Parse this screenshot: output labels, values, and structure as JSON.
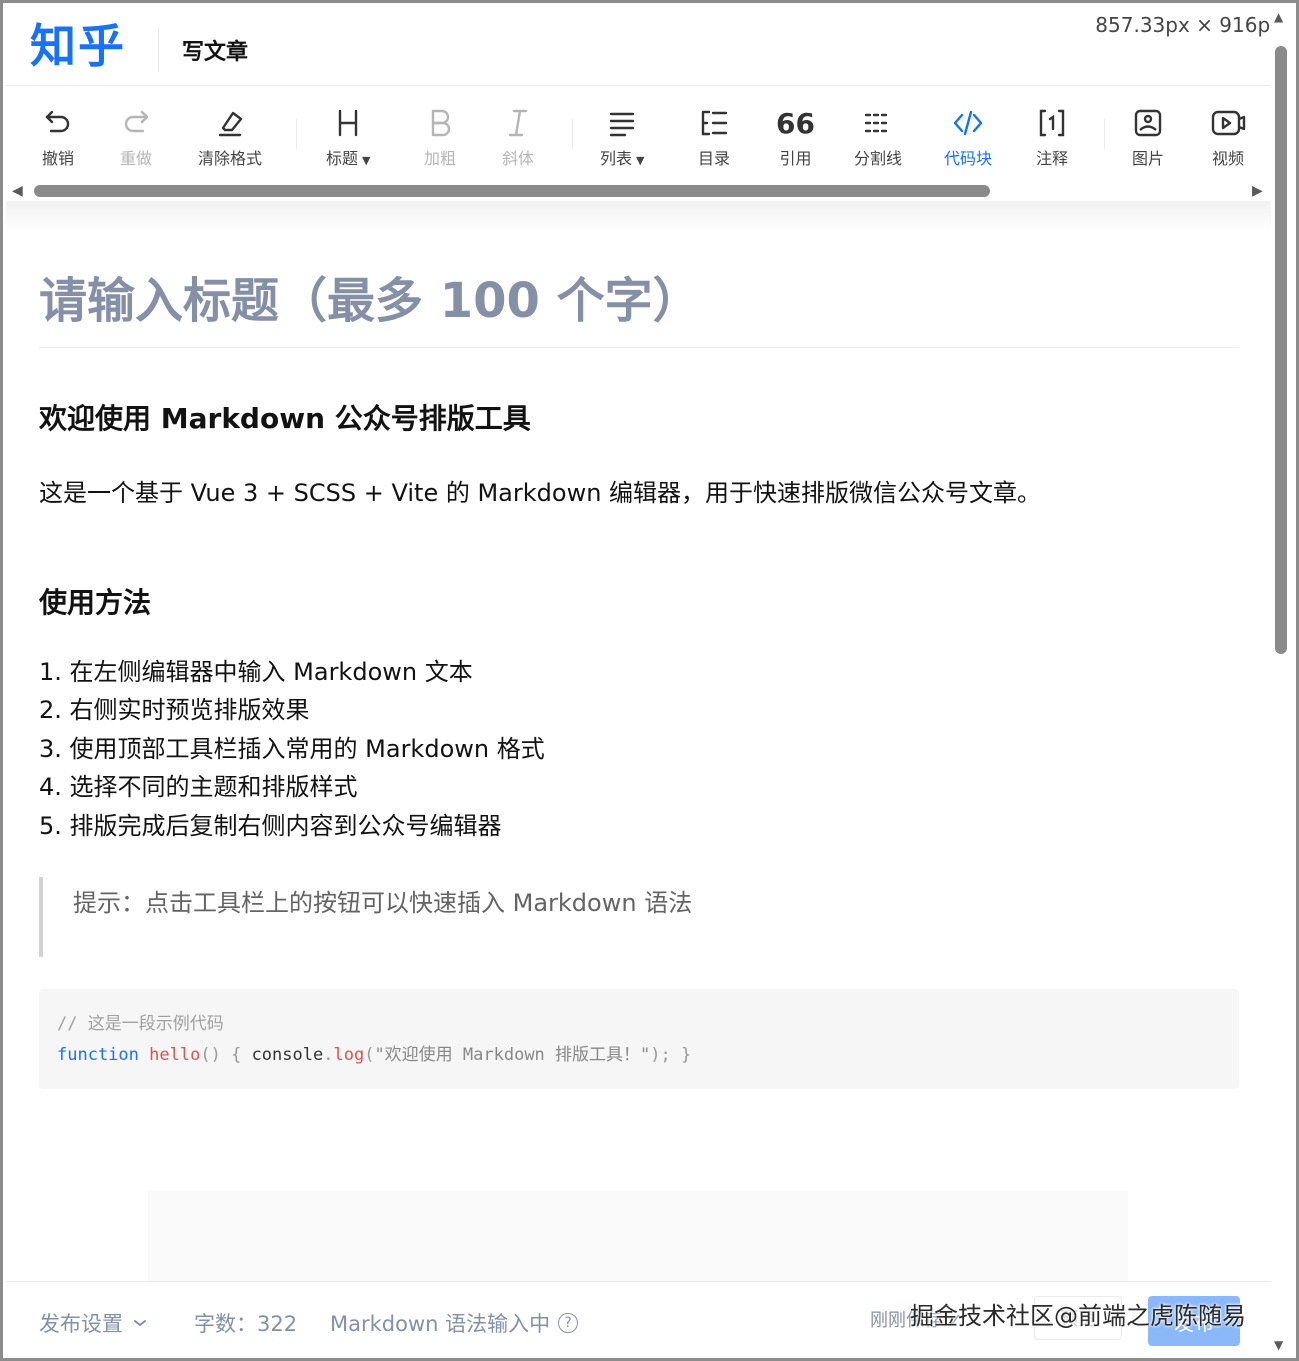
{
  "header": {
    "logo": "知乎",
    "title": "写文章",
    "dimensions_overlay": "857.33px × 916px"
  },
  "toolbar": {
    "undo": "撤销",
    "redo": "重做",
    "clear_format": "清除格式",
    "heading": "标题",
    "bold": "加粗",
    "italic": "斜体",
    "list": "列表",
    "toc": "目录",
    "quote": "引用",
    "divider": "分割线",
    "code_block": "代码块",
    "annotation": "注释",
    "image": "图片",
    "video": "视频"
  },
  "editor": {
    "title_placeholder": "请输入标题（最多 100 个字）",
    "h2_welcome": "欢迎使用 Markdown 公众号排版工具",
    "intro": "这是一个基于 Vue 3 + SCSS + Vite 的 Markdown 编辑器，用于快速排版微信公众号文章。",
    "h2_usage": "使用方法",
    "steps": [
      "1. 在左侧编辑器中输入 Markdown 文本",
      "2. 右侧实时预览排版效果",
      "3. 使用顶部工具栏插入常用的 Markdown 格式",
      "4. 选择不同的主题和排版样式",
      "5. 排版完成后复制右侧内容到公众号编辑器"
    ],
    "tip": "提示：点击工具栏上的按钮可以快速插入 Markdown 语法",
    "code": {
      "comment": "// 这是一段示例代码",
      "keyword": "function",
      "fn_name": "hello",
      "parens": "()",
      "brace_open": "{",
      "obj": "console",
      "dot": ".",
      "method": "log",
      "arg_open": "(",
      "string": "\"欢迎使用 Markdown 排版工具！\"",
      "arg_close": ");",
      "brace_close": "}"
    }
  },
  "footer": {
    "publish_settings": "发布设置",
    "word_count": "字数：322",
    "markdown_status": "Markdown 语法输入中",
    "saved": "刚刚保存 ✓",
    "preview": "预览",
    "publish": "发布",
    "watermark": "掘金技术社区@前端之虎陈随易"
  }
}
